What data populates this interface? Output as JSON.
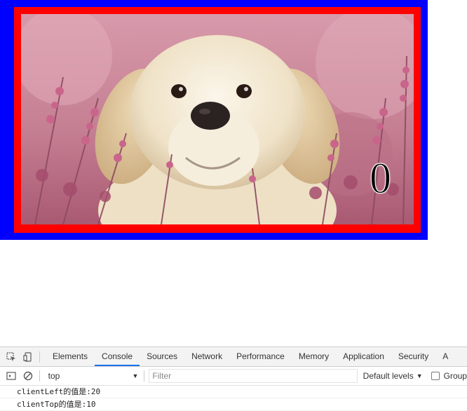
{
  "page": {
    "counter_text": "0",
    "colors": {
      "outer_box": "#0000ff",
      "inner_box": "#ff0000",
      "devtools_accent": "#1a73e8"
    }
  },
  "devtools": {
    "icons": [
      "inspect-element-icon",
      "device-toolbar-icon"
    ],
    "tabs": [
      {
        "label": "Elements",
        "active": false
      },
      {
        "label": "Console",
        "active": true
      },
      {
        "label": "Sources",
        "active": false
      },
      {
        "label": "Network",
        "active": false
      },
      {
        "label": "Performance",
        "active": false
      },
      {
        "label": "Memory",
        "active": false
      },
      {
        "label": "Application",
        "active": false
      },
      {
        "label": "Security",
        "active": false
      },
      {
        "label": "A",
        "active": false
      }
    ],
    "toolbar": {
      "context": "top",
      "filter_placeholder": "Filter",
      "levels": "Default levels",
      "group_label": "Group"
    },
    "console_lines": [
      "clientLeft的值是:20",
      "clientTop的值是:10"
    ]
  }
}
